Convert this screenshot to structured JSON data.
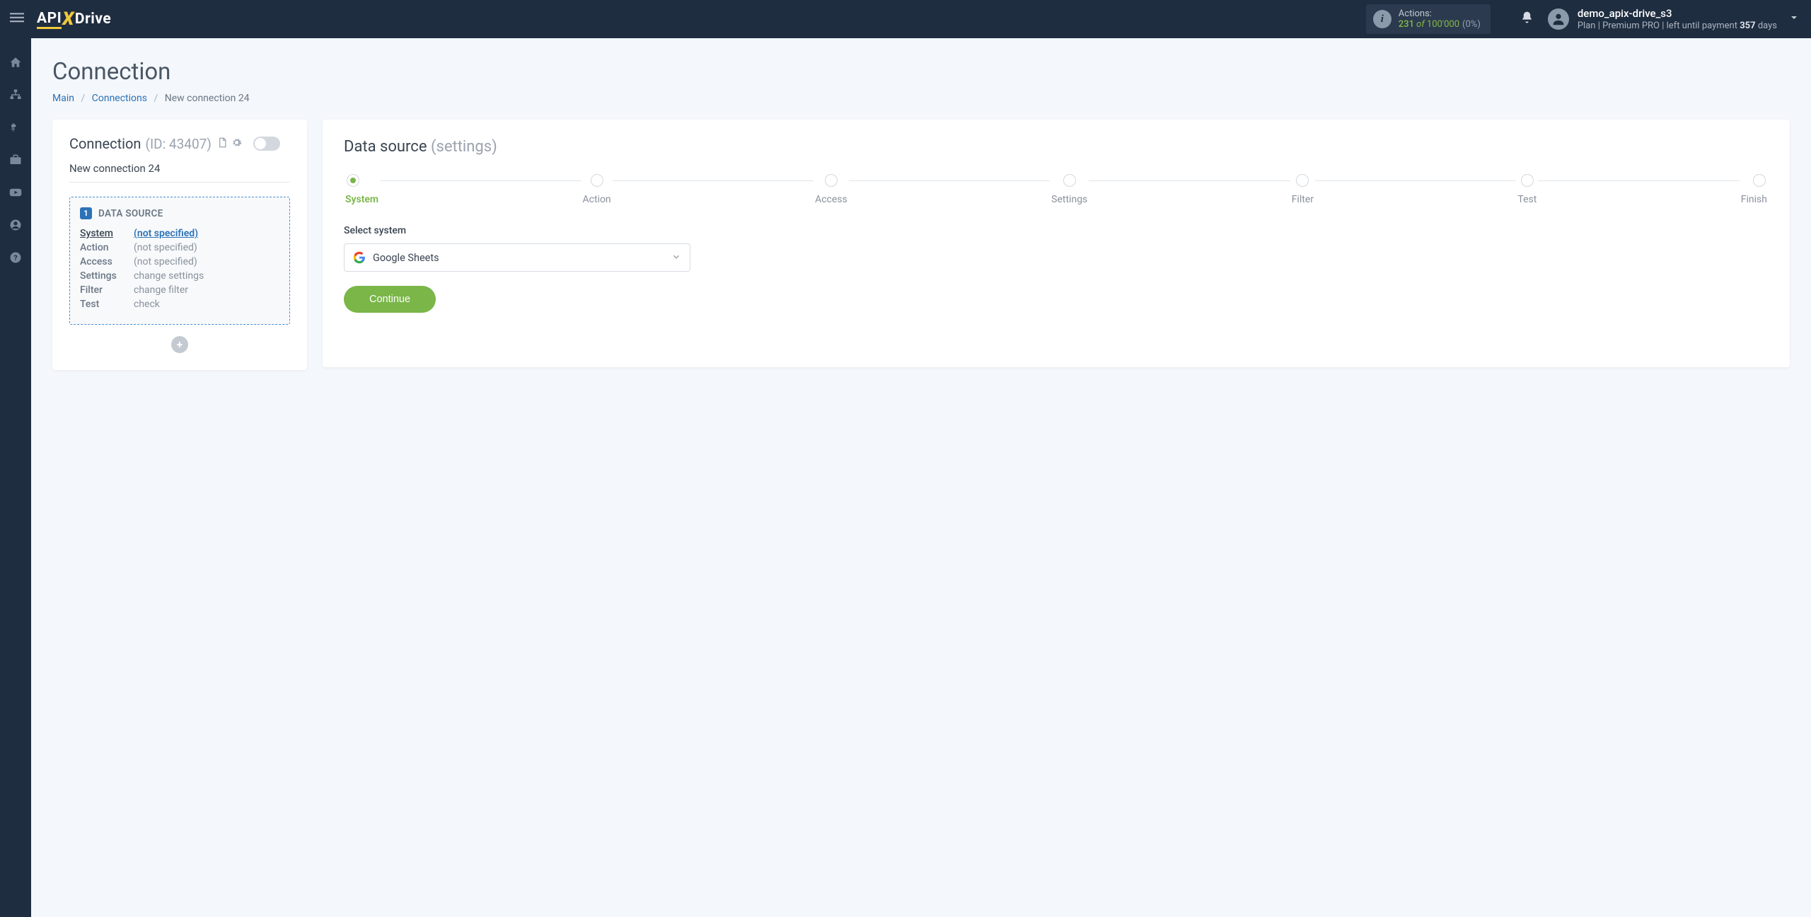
{
  "topnav": {
    "actions_label": "Actions:",
    "actions_used": "231",
    "actions_of": " of ",
    "actions_quota": "100'000",
    "actions_pct": "(0%)",
    "user_name": "demo_apix-drive_s3",
    "plan_prefix": "Plan  | ",
    "plan_name": "Premium PRO",
    "plan_suffix": " |  left until payment ",
    "days_left": "357",
    "days_word": " days"
  },
  "page": {
    "title": "Connection",
    "crumb_main": "Main",
    "crumb_connections": "Connections",
    "crumb_current": "New connection 24"
  },
  "left_card": {
    "heading": "Connection",
    "id_label": "(ID: 43407)",
    "conn_name": "New connection 24",
    "box_number": "1",
    "box_title": "DATA SOURCE",
    "rows": [
      {
        "k": "System",
        "v": "(not specified)",
        "active": true
      },
      {
        "k": "Action",
        "v": "(not specified)",
        "active": false
      },
      {
        "k": "Access",
        "v": "(not specified)",
        "active": false
      },
      {
        "k": "Settings",
        "v": "change settings",
        "active": false
      },
      {
        "k": "Filter",
        "v": "change filter",
        "active": false
      },
      {
        "k": "Test",
        "v": "check",
        "active": false
      }
    ]
  },
  "right_card": {
    "heading": "Data source",
    "heading_sub": "(settings)",
    "steps": [
      "System",
      "Action",
      "Access",
      "Settings",
      "Filter",
      "Test",
      "Finish"
    ],
    "active_step": 0,
    "field_label": "Select system",
    "selected_system": "Google Sheets",
    "continue": "Continue"
  }
}
